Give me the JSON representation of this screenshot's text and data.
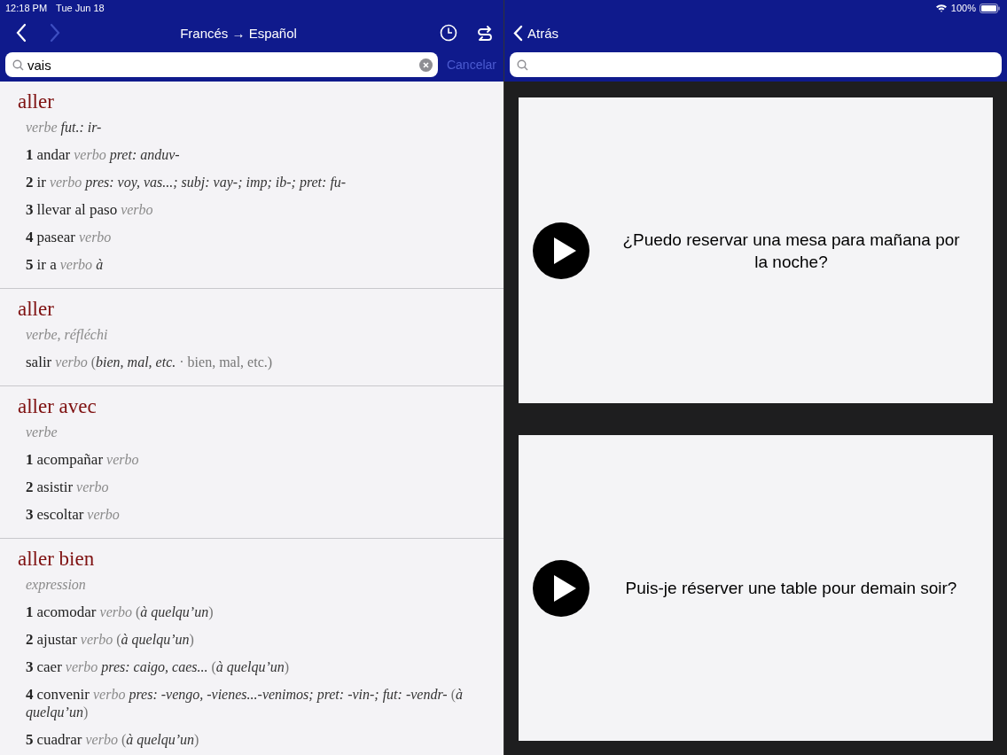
{
  "status_bar": {
    "time": "12:18 PM",
    "date": "Tue Jun 18",
    "battery_text": "100%"
  },
  "dictionary": {
    "title": "Francés → Español",
    "back_enabled": true,
    "forward_enabled": false,
    "search": {
      "value": "vais"
    },
    "cancel": "Cancelar",
    "entries": [
      {
        "headword": "aller",
        "pos": "verbe",
        "note": "fut.: ir-",
        "senses": [
          {
            "num": "1",
            "term": "andar",
            "pos": "verbo",
            "note": "*pret: anduv-*"
          },
          {
            "num": "2",
            "term": "ir",
            "pos": "verbo",
            "note": "*pres: voy, vas...; subj: vay-; imp; ib-; pret: fu-*"
          },
          {
            "num": "3",
            "term": "llevar al paso",
            "pos": "verbo"
          },
          {
            "num": "4",
            "term": "pasear",
            "pos": "verbo"
          },
          {
            "num": "5",
            "term": "ir a",
            "pos": "verbo",
            "note": "*à*"
          }
        ]
      },
      {
        "headword": "aller",
        "pos": "verbe, réfléchi",
        "senses": [
          {
            "term": "salir",
            "pos": "verbo",
            "note": "(*bien, mal, etc.* · bien, mal, etc.)"
          }
        ]
      },
      {
        "headword": "aller avec",
        "pos": "verbe",
        "senses": [
          {
            "num": "1",
            "term": "acompañar",
            "pos": "verbo"
          },
          {
            "num": "2",
            "term": "asistir",
            "pos": "verbo"
          },
          {
            "num": "3",
            "term": "escoltar",
            "pos": "verbo"
          }
        ]
      },
      {
        "headword": "aller bien",
        "pos": "expression",
        "senses": [
          {
            "num": "1",
            "term": "acomodar",
            "pos": "verbo",
            "note": "(*à quelqu’un*)"
          },
          {
            "num": "2",
            "term": "ajustar",
            "pos": "verbo",
            "note": "(*à quelqu’un*)"
          },
          {
            "num": "3",
            "term": "caer",
            "pos": "verbo",
            "note": "*pres: caigo, caes...* (*à quelqu’un*)"
          },
          {
            "num": "4",
            "term": "convenir",
            "pos": "verbo",
            "note": "*pres: -vengo, -vienes...-venimos; pret: -vin-; fut: -vendr-* (*à quelqu’un*)"
          },
          {
            "num": "5",
            "term": "cuadrar",
            "pos": "verbo",
            "note": "(*à quelqu’un*)"
          }
        ]
      }
    ]
  },
  "phrases": {
    "back": "Atrás",
    "cards": [
      {
        "text": "¿Puedo reservar una mesa para mañana por la noche?"
      },
      {
        "text": "Puis-je réserver une table pour demain soir?"
      }
    ]
  }
}
